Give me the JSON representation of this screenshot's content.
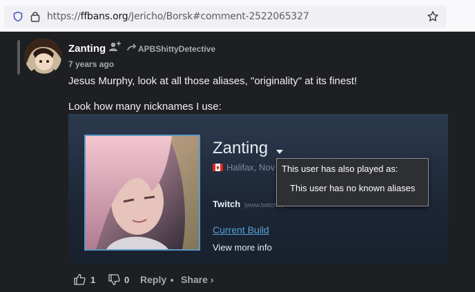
{
  "browser": {
    "url_prefix": "https://",
    "url_host": "ffbans.org",
    "url_path": "/Jericho/Borsk#comment-2522065327"
  },
  "comment": {
    "username": "Zanting",
    "reply_to": "APBShittyDetective",
    "time": "7 years ago",
    "text_line1": "Jesus Murphy, look at all those aliases, \"originality\" at its finest!",
    "text_line2": "Look how many nicknames I use:",
    "likes": "1",
    "dislikes": "0",
    "reply_label": "Reply",
    "share_label": "Share ›"
  },
  "profile_card": {
    "name": "Zanting",
    "location": "Halifax, Nov",
    "twitch_label": "Twitch",
    "twitch_url": "[www.twitch...]",
    "build_link": "Current Build",
    "more_info": "View more info",
    "tooltip_title": "This user has also played as:",
    "tooltip_body": "This user has no known aliases"
  },
  "colors": {
    "page_bg": "#1e1f22",
    "link": "#5aa3d8",
    "card_bg": "#1c2636"
  }
}
